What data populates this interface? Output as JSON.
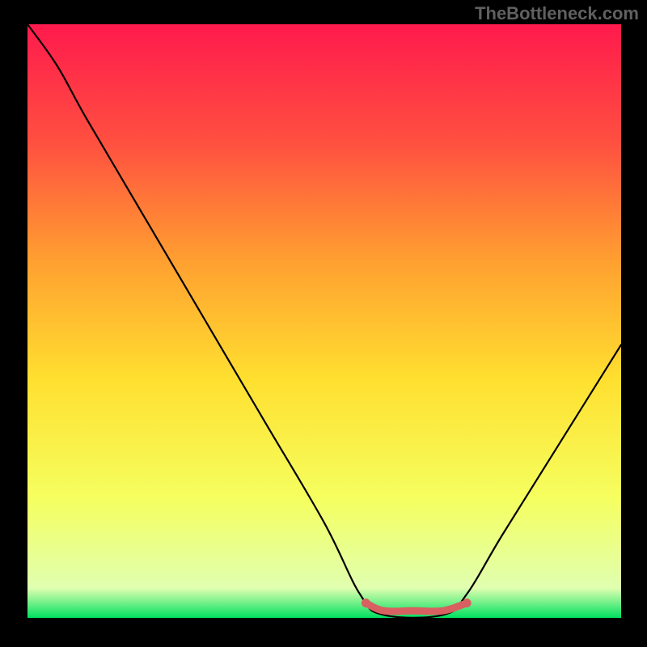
{
  "watermark": "TheBottleneck.com",
  "chart_data": {
    "type": "line",
    "title": "",
    "xlabel": "",
    "ylabel": "",
    "xlim": [
      0,
      100
    ],
    "ylim": [
      0,
      100
    ],
    "gradient_stops": [
      {
        "offset": 0,
        "color": "#ff1a4d"
      },
      {
        "offset": 20,
        "color": "#ff5040"
      },
      {
        "offset": 40,
        "color": "#ffa030"
      },
      {
        "offset": 60,
        "color": "#ffe030"
      },
      {
        "offset": 80,
        "color": "#f5ff60"
      },
      {
        "offset": 95,
        "color": "#e0ffb0"
      },
      {
        "offset": 100,
        "color": "#00e060"
      }
    ],
    "series": [
      {
        "name": "bottleneck-curve",
        "color": "#000000",
        "points": [
          {
            "x": 0,
            "y": 100
          },
          {
            "x": 5,
            "y": 93
          },
          {
            "x": 10,
            "y": 84
          },
          {
            "x": 20,
            "y": 67
          },
          {
            "x": 30,
            "y": 50
          },
          {
            "x": 40,
            "y": 33
          },
          {
            "x": 50,
            "y": 16
          },
          {
            "x": 56,
            "y": 4
          },
          {
            "x": 60,
            "y": 0.5
          },
          {
            "x": 70,
            "y": 0.5
          },
          {
            "x": 74,
            "y": 4
          },
          {
            "x": 80,
            "y": 14
          },
          {
            "x": 90,
            "y": 30
          },
          {
            "x": 100,
            "y": 46
          }
        ]
      },
      {
        "name": "optimal-band",
        "color": "#d86060",
        "points": [
          {
            "x": 57,
            "y": 2.5
          },
          {
            "x": 60,
            "y": 1.2
          },
          {
            "x": 65,
            "y": 1.2
          },
          {
            "x": 70,
            "y": 1.2
          },
          {
            "x": 74,
            "y": 2.5
          }
        ]
      }
    ]
  }
}
